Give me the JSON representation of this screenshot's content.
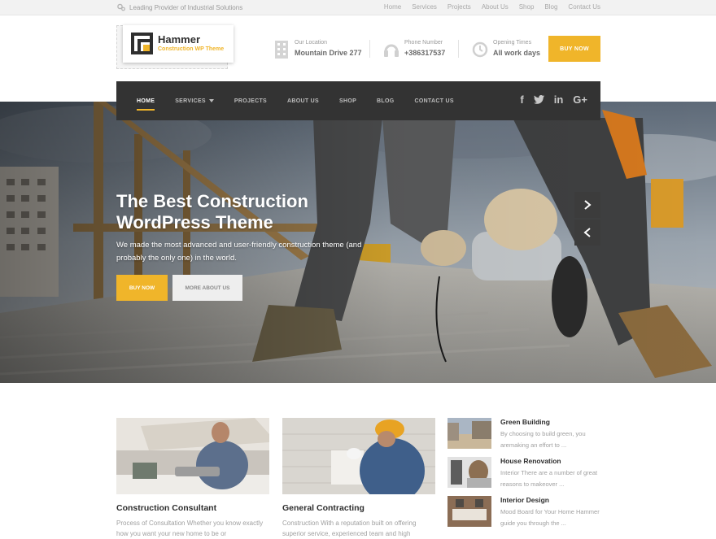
{
  "topbar": {
    "tagline": "Leading Provider of Industrial Solutions",
    "links": [
      "Home",
      "Services",
      "Projects",
      "About Us",
      "Shop",
      "Blog",
      "Contact Us"
    ]
  },
  "logo": {
    "title": "Hammer",
    "subtitle": "Construction WP Theme"
  },
  "header_info": [
    {
      "icon": "building-icon",
      "label": "Our Location",
      "value": "Mountain Drive 277"
    },
    {
      "icon": "headset-icon",
      "label": "Phone Number",
      "value": "+386317537"
    },
    {
      "icon": "clock-icon",
      "label": "Opening Times",
      "value": "All work days"
    }
  ],
  "header_buy": "BUY NOW",
  "nav": {
    "items": [
      "HOME",
      "SERVICES",
      "PROJECTS",
      "ABOUT US",
      "SHOP",
      "BLOG",
      "CONTACT US"
    ],
    "active": "HOME",
    "social": [
      "facebook-icon",
      "twitter-icon",
      "linkedin-icon",
      "google-plus-icon"
    ]
  },
  "hero": {
    "title": "The Best Construction WordPress Theme",
    "text": "We made the most advanced and user-friendly construction theme (and probably the only one) in the world.",
    "buy_label": "BUY NOW",
    "more_label": "MORE ABOUT US"
  },
  "cards": [
    {
      "title": "Construction Consultant",
      "desc": "Process of Consultation Whether you know exactly how you want your new home to be or"
    },
    {
      "title": "General Contracting",
      "desc": "Construction With a reputation built on offering superior service, experienced team and high"
    }
  ],
  "posts": [
    {
      "title": "Green Building",
      "desc": "By choosing to build green, you aremaking an effort to ..."
    },
    {
      "title": "House Renovation",
      "desc": "Interior There are a number of great reasons to makeover ..."
    },
    {
      "title": "Interior Design",
      "desc": "Mood Board for Your Home Hammer guide you through the ..."
    }
  ],
  "colors": {
    "accent": "#f0b52a",
    "nav_bg": "#333333",
    "topbar_bg": "#f2f2f2"
  }
}
